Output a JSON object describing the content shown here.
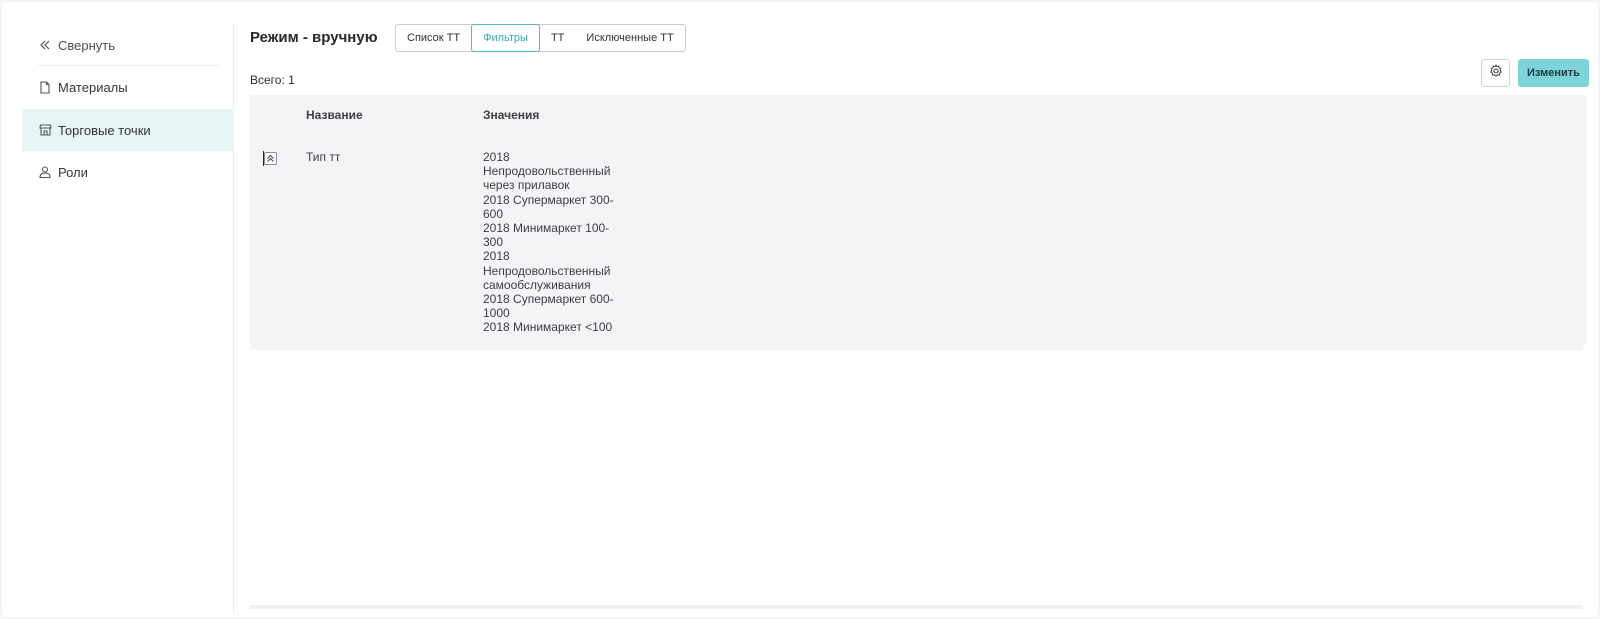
{
  "sidebar": {
    "items": [
      {
        "label": "Свернуть",
        "icon": "double-chevron-left-icon"
      },
      {
        "label": "Материалы",
        "icon": "document-icon"
      },
      {
        "label": "Торговые точки",
        "icon": "store-icon"
      },
      {
        "label": "Роли",
        "icon": "user-icon"
      }
    ],
    "active_index": 2
  },
  "header": {
    "mode_title": "Режим - вручную",
    "tabs": [
      "Список ТТ",
      "Фильтры",
      "ТТ",
      "Исключенные ТТ"
    ],
    "active_tab": "Фильтры",
    "total": "Всего: 1",
    "edit_label": "Изменить"
  },
  "table": {
    "columns": [
      "Название",
      "Значения"
    ],
    "rows": [
      {
        "name": "Тип тт",
        "values": [
          "2018",
          "Непродовольственный",
          "через прилавок",
          "2018 Супермаркет 300-",
          "600",
          "2018 Минимаркет 100-",
          "300",
          "2018",
          "Непродовольственный",
          "самообслуживания",
          "2018 Супермаркет 600-",
          "1000",
          "2018 Минимаркет <100"
        ]
      }
    ]
  },
  "colors": {
    "accent": "#4fbcc6",
    "edit_button": "#7ed3d9",
    "active_sidebar": "#e7f5f6",
    "table_bg": "#f4f4f7"
  }
}
